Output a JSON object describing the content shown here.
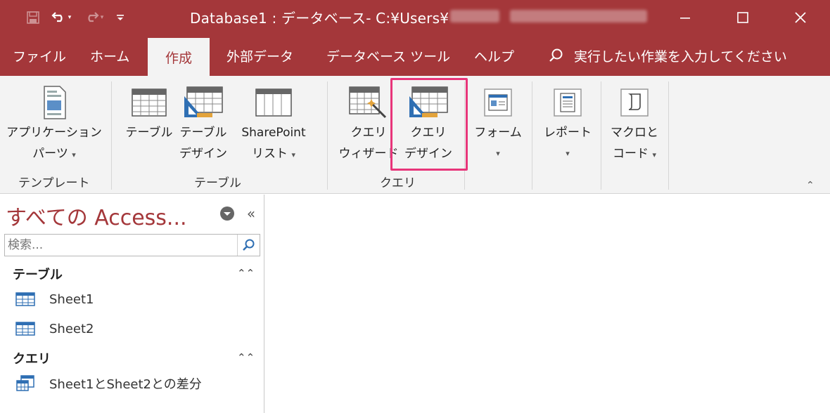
{
  "titlebar": {
    "title": "Database1 : データベース- C:¥Users¥",
    "save_icon": "save-icon",
    "undo_icon": "undo-icon",
    "redo_icon": "redo-icon",
    "minimize_icon": "minimize-icon",
    "maximize_icon": "maximize-icon",
    "close_icon": "close-icon"
  },
  "tabs": [
    {
      "label": "ファイル"
    },
    {
      "label": "ホーム"
    },
    {
      "label": "作成"
    },
    {
      "label": "外部データ"
    },
    {
      "label": "データベース ツール"
    },
    {
      "label": "ヘルプ"
    }
  ],
  "active_tab": "作成",
  "tellme": {
    "placeholder": "実行したい作業を入力してください"
  },
  "ribbon": {
    "template_group": {
      "label": "テンプレート",
      "app_parts_line1": "アプリケーション",
      "app_parts_line2": "パーツ"
    },
    "table_group": {
      "label": "テーブル",
      "table": "テーブル",
      "table_design_line1": "テーブル",
      "table_design_line2": "デザイン",
      "sharepoint_line1": "SharePoint",
      "sharepoint_line2": "リスト"
    },
    "query_group": {
      "label": "クエリ",
      "wizard_line1": "クエリ",
      "wizard_line2": "ウィザード",
      "design_line1": "クエリ",
      "design_line2": "デザイン"
    },
    "form_label": "フォーム",
    "report_label": "レポート",
    "macro_line1": "マクロと",
    "macro_line2": "コード"
  },
  "nav": {
    "title": "すべての Access...",
    "search_placeholder": "検索...",
    "sections": [
      {
        "label": "テーブル",
        "items": [
          "Sheet1",
          "Sheet2"
        ]
      },
      {
        "label": "クエリ",
        "items": [
          "Sheet1とSheet2との差分"
        ]
      }
    ]
  },
  "colors": {
    "accent": "#a4373a",
    "highlight": "#e8357a"
  }
}
